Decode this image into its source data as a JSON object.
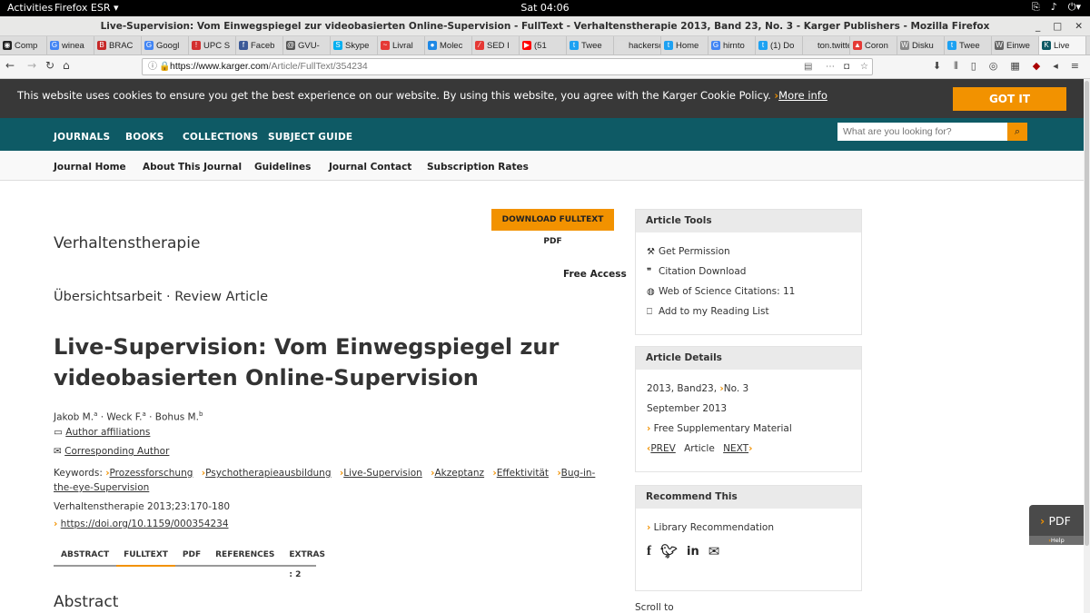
{
  "system": {
    "activities": "Activities",
    "app_menu": "Firefox ESR ▾",
    "clock": "Sat 04:06",
    "tray_icons": [
      "network-icon",
      "volume-icon",
      "power-icon"
    ]
  },
  "window": {
    "title": "Live-Supervision: Vom Einwegspiegel zur videobasierten Online-Supervision - FullText - Verhaltenstherapie 2013, Band 23, No. 3 - Karger Publishers - Mozilla Firefox"
  },
  "tabs": [
    {
      "label": "Comp",
      "icon": "github-icon",
      "color": "#222222",
      "glyph": "◉"
    },
    {
      "label": "winea",
      "icon": "google-icon",
      "color": "#4285f4",
      "glyph": "G"
    },
    {
      "label": "BRAC",
      "icon": "bracket-icon",
      "color": "#c62828",
      "glyph": "B"
    },
    {
      "label": "Googl",
      "icon": "google-icon",
      "color": "#4285f4",
      "glyph": "G"
    },
    {
      "label": "UPC S",
      "icon": "upc-icon",
      "color": "#d32f2f",
      "glyph": "!"
    },
    {
      "label": "Faceb",
      "icon": "facebook-icon",
      "color": "#3b5998",
      "glyph": "f"
    },
    {
      "label": "GVU-",
      "icon": "at-icon",
      "color": "#555555",
      "glyph": "@"
    },
    {
      "label": "Skype",
      "icon": "skype-icon",
      "color": "#00aff0",
      "glyph": "S"
    },
    {
      "label": "Livral",
      "icon": "livral-icon",
      "color": "#e53935",
      "glyph": "~"
    },
    {
      "label": "Molec",
      "icon": "molecule-icon",
      "color": "#1e88e5",
      "glyph": "●"
    },
    {
      "label": "SED I",
      "icon": "chart-icon",
      "color": "#e53935",
      "glyph": "⁄"
    },
    {
      "label": "(51",
      "icon": "youtube-icon",
      "color": "#ff0000",
      "glyph": "▶"
    },
    {
      "label": "Twee",
      "icon": "twitter-icon",
      "color": "#1da1f2",
      "glyph": "t"
    },
    {
      "label": "hackersc",
      "icon": "blank-icon",
      "color": "#dddddd",
      "glyph": ""
    },
    {
      "label": "Home",
      "icon": "twitter-icon",
      "color": "#1da1f2",
      "glyph": "t"
    },
    {
      "label": "hirnto",
      "icon": "google-icon",
      "color": "#4285f4",
      "glyph": "G"
    },
    {
      "label": "(1) Do",
      "icon": "twitter-icon",
      "color": "#1da1f2",
      "glyph": "t"
    },
    {
      "label": "ton.twitte",
      "icon": "blank-icon",
      "color": "#dddddd",
      "glyph": ""
    },
    {
      "label": "Coron",
      "icon": "corona-icon",
      "color": "#e53935",
      "glyph": "▲"
    },
    {
      "label": "Disku",
      "icon": "wikipedia-icon",
      "color": "#888888",
      "glyph": "W"
    },
    {
      "label": "Twee",
      "icon": "twitter-icon",
      "color": "#1da1f2",
      "glyph": "t"
    },
    {
      "label": "Einwe",
      "icon": "wikipedia-icon",
      "color": "#666666",
      "glyph": "W"
    },
    {
      "label": "Live",
      "icon": "karger-icon",
      "color": "#0e5a65",
      "glyph": "K"
    }
  ],
  "navbar": {
    "url_domain": "https://www.karger.com",
    "url_path": "/Article/FullText/354234"
  },
  "cookie": {
    "text": "This website uses cookies to ensure you get the best experience on our website. By using this website, you agree with the Karger Cookie Policy.",
    "more": "More info",
    "button": "GOT IT"
  },
  "main_nav": {
    "items": [
      "JOURNALS",
      "BOOKS",
      "COLLECTIONS",
      "SUBJECT GUIDE"
    ],
    "search_placeholder": "What are you looking for?"
  },
  "sub_nav": {
    "items": [
      "Journal Home",
      "About This Journal",
      "Guidelines",
      "Journal Contact",
      "Subscription Rates"
    ]
  },
  "article": {
    "download_button": "DOWNLOAD FULLTEXT PDF",
    "journal": "Verhaltenstherapie",
    "access": "Free Access",
    "type": "Übersichtsarbeit · Review Article",
    "title": "Live-Supervision: Vom Einwegspiegel zur videobasierten Online-Supervision",
    "authors": [
      {
        "name": "Jakob M.",
        "sup": "a",
        "sep": " · "
      },
      {
        "name": "Weck F.",
        "sup": "a",
        "sep": " · "
      },
      {
        "name": "Bohus M.",
        "sup": "b",
        "sep": ""
      }
    ],
    "affiliations": "Author affiliations",
    "corresponding": "Corresponding Author",
    "keywords_label": "Keywords:",
    "keywords": [
      "Prozessforschung",
      "Psychotherapieausbildung",
      "Live-Supervision",
      "Akzeptanz",
      "Effektivität",
      "Bug-in-the-eye-Supervision"
    ],
    "citation": "Verhaltenstherapie 2013;23:170-180",
    "doi": "https://doi.org/10.1159/000354234",
    "tabs": [
      "ABSTRACT",
      "FULLTEXT",
      "PDF",
      "REFERENCES",
      "EXTRAS : 2"
    ],
    "active_tab": "FULLTEXT",
    "section_heading": "Abstract"
  },
  "tools": {
    "heading": "Article Tools",
    "items": [
      {
        "label": "Get Permission",
        "icon": "gavel-icon"
      },
      {
        "label": "Citation Download",
        "icon": "quote-icon"
      },
      {
        "label": "Web of Science Citations: 11",
        "icon": "globe-icon"
      },
      {
        "label": "Add to my Reading List",
        "icon": "bookmark-icon"
      }
    ]
  },
  "details": {
    "heading": "Article Details",
    "volume": "2013, Band23,",
    "issue": "No. 3",
    "date": "September 2013",
    "supplementary": "Free Supplementary Material",
    "prev": "PREV",
    "article": "Article",
    "next": "NEXT"
  },
  "recommend": {
    "heading": "Recommend This",
    "library": "Library Recommendation",
    "social": [
      "facebook-icon",
      "twitter-icon",
      "linkedin-icon",
      "email-icon"
    ]
  },
  "scroll_to": "Scroll to",
  "pdf_side": {
    "label": "PDF",
    "help": "Help"
  },
  "colors": {
    "accent": "#f29200",
    "teal": "#0e5a65",
    "cookie_bg": "#383838"
  }
}
